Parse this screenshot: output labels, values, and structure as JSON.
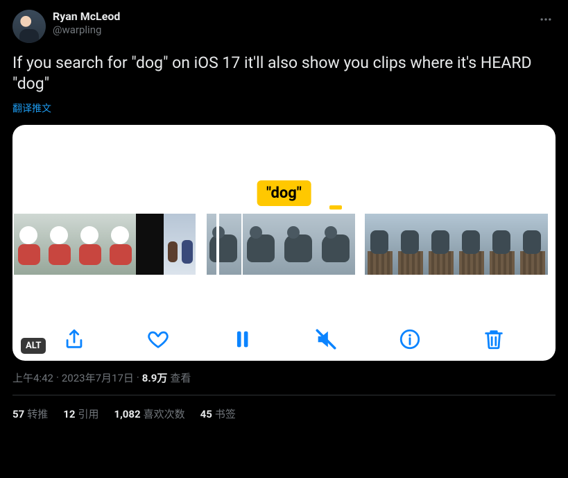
{
  "user": {
    "display_name": "Ryan McLeod",
    "handle": "@warpling"
  },
  "tweet_text": "If you search for \"dog\" on iOS 17 it'll also show you clips where it's HEARD \"dog\"",
  "translate_label": "翻译推文",
  "media": {
    "search_label": "\"dog\"",
    "alt_badge": "ALT"
  },
  "meta": {
    "time": "上午4:42",
    "dot1": " · ",
    "date": "2023年7月17日",
    "dot2": " · ",
    "views_count": "8.9万",
    "views_label": " 查看"
  },
  "stats": {
    "retweets": {
      "count": "57",
      "label": "转推"
    },
    "quotes": {
      "count": "12",
      "label": "引用"
    },
    "likes": {
      "count": "1,082",
      "label": "喜欢次数"
    },
    "bookmarks": {
      "count": "45",
      "label": "书签"
    }
  }
}
